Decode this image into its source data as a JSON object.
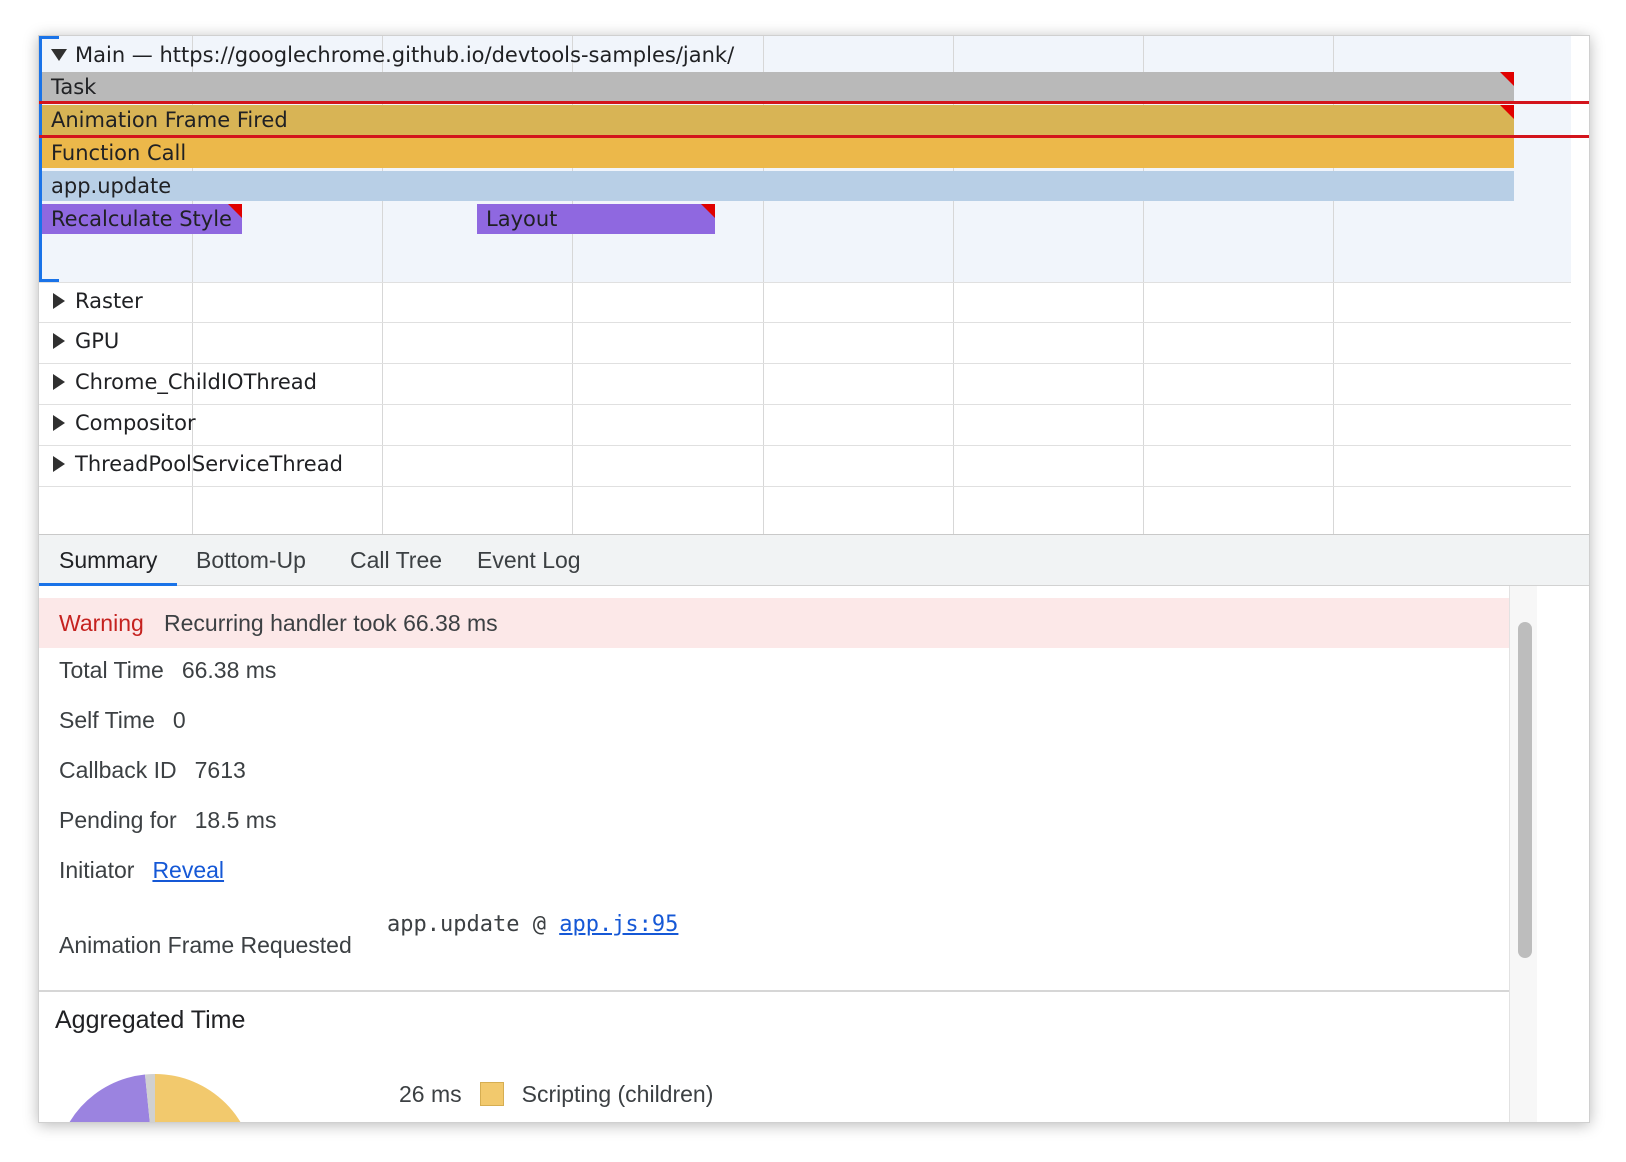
{
  "timeline": {
    "main_track": {
      "header": "Main — https://googlechrome.github.io/devtools-samples/jank/",
      "events": {
        "task": "Task",
        "animation_frame_fired": "Animation Frame Fired",
        "function_call": "Function Call",
        "app_update": "app.update",
        "recalculate_style": "Recalculate Style",
        "layout": "Layout"
      }
    },
    "threads": [
      "Raster",
      "GPU",
      "Chrome_ChildIOThread",
      "Compositor",
      "ThreadPoolServiceThread"
    ]
  },
  "tabs": [
    "Summary",
    "Bottom-Up",
    "Call Tree",
    "Event Log"
  ],
  "active_tab": "Summary",
  "summary": {
    "warning_label": "Warning",
    "warning_text": "Recurring handler took 66.38 ms",
    "total_time_label": "Total Time",
    "total_time_value": "66.38 ms",
    "self_time_label": "Self Time",
    "self_time_value": "0",
    "callback_id_label": "Callback ID",
    "callback_id_value": "7613",
    "pending_for_label": "Pending for",
    "pending_for_value": "18.5 ms",
    "initiator_label": "Initiator",
    "initiator_link": "Reveal",
    "afr_label": "Animation Frame Requested",
    "afr_function": "app.update",
    "afr_at": "@",
    "afr_source": "app.js:95",
    "aggregated_time_title": "Aggregated Time",
    "legend": [
      {
        "value": "26 ms",
        "label": "Scripting (children)",
        "color": "#f2c96d"
      }
    ]
  },
  "colors": {
    "task": "#b9b9b9",
    "animation_frame_fired": "#d8b455",
    "function_call": "#ecb84a",
    "app_update": "#b8cfe6",
    "rendering": "#8f68e0",
    "selection": "#d3141c",
    "accent": "#1a73e8",
    "warning_bg": "#fce8e8",
    "warning_text": "#c5221f"
  }
}
